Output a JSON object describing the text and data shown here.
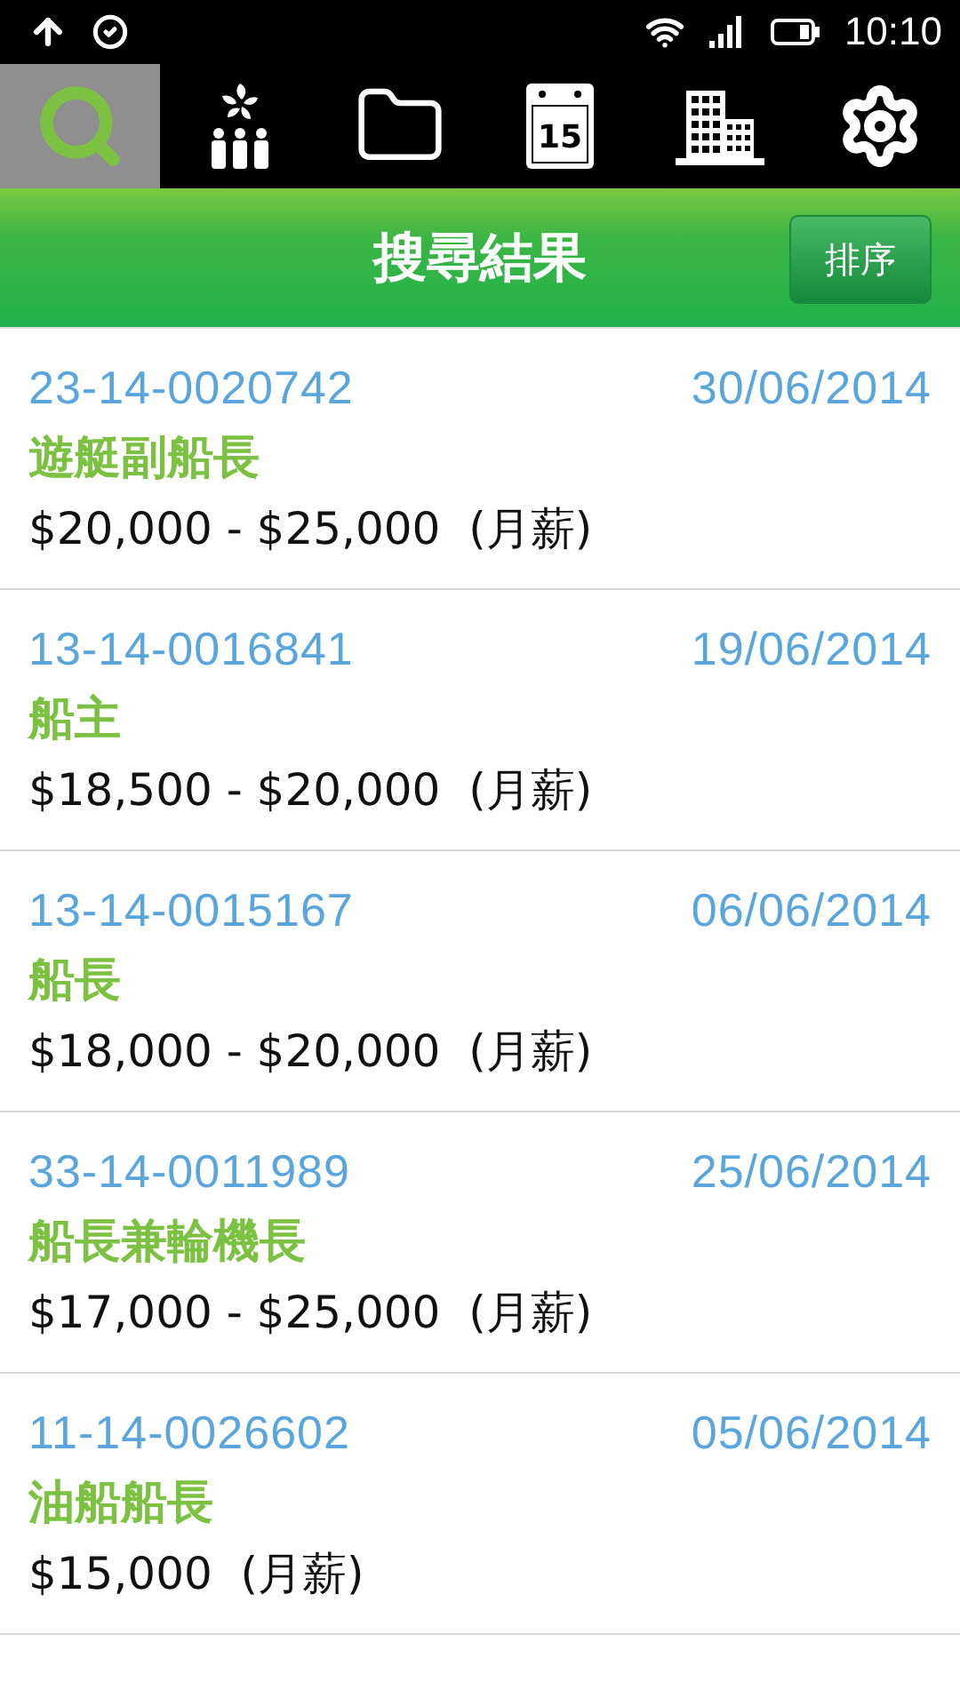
{
  "status_bar": {
    "time": "10:10"
  },
  "nav_tabs": [
    {
      "kind": "search",
      "selected": true
    },
    {
      "kind": "people",
      "selected": false
    },
    {
      "kind": "folder",
      "selected": false
    },
    {
      "kind": "calendar",
      "label": "15",
      "selected": false
    },
    {
      "kind": "building",
      "selected": false
    },
    {
      "kind": "settings",
      "selected": false
    }
  ],
  "header": {
    "title": "搜尋結果",
    "sort_button": "排序"
  },
  "results": [
    {
      "code": "23-14-0020742",
      "date": "30/06/2014",
      "title": "遊艇副船長",
      "salary": "$20,000 - $25,000  (月薪)"
    },
    {
      "code": "13-14-0016841",
      "date": "19/06/2014",
      "title": "船主",
      "salary": "$18,500 - $20,000  (月薪)"
    },
    {
      "code": "13-14-0015167",
      "date": "06/06/2014",
      "title": "船長",
      "salary": "$18,000 - $20,000  (月薪)"
    },
    {
      "code": "33-14-0011989",
      "date": "25/06/2014",
      "title": "船長兼輪機長",
      "salary": "$17,000 - $25,000  (月薪)"
    },
    {
      "code": "11-14-0026602",
      "date": "05/06/2014",
      "title": "油船船長",
      "salary": "$15,000  (月薪)"
    }
  ]
}
